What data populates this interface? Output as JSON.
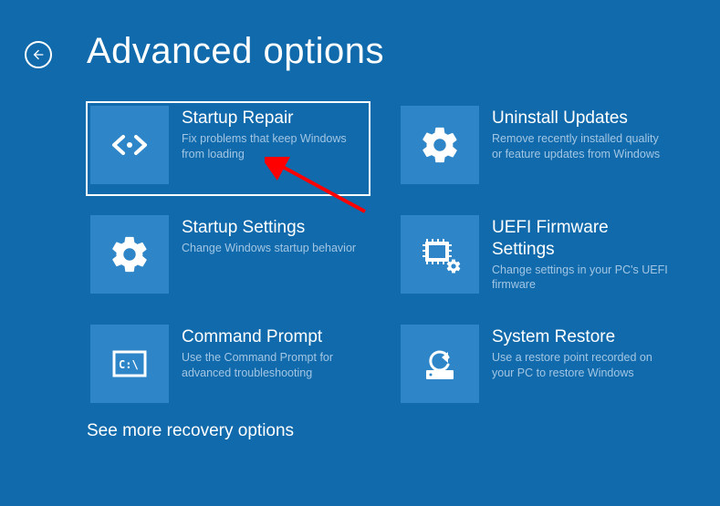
{
  "header": {
    "title": "Advanced options"
  },
  "tiles": {
    "startup_repair": {
      "title": "Startup Repair",
      "desc": "Fix problems that keep Windows from loading"
    },
    "uninstall_updates": {
      "title": "Uninstall Updates",
      "desc": "Remove recently installed quality or feature updates from Windows"
    },
    "startup_settings": {
      "title": "Startup Settings",
      "desc": "Change Windows startup behavior"
    },
    "uefi": {
      "title": "UEFI Firmware Settings",
      "desc": "Change settings in your PC's UEFI firmware"
    },
    "command_prompt": {
      "title": "Command Prompt",
      "desc": "Use the Command Prompt for advanced troubleshooting"
    },
    "system_restore": {
      "title": "System Restore",
      "desc": "Use a restore point recorded on your PC to restore Windows"
    }
  },
  "more_link": "See more recovery options",
  "colors": {
    "background": "#116aab",
    "tile_icon_bg": "#2e86c8",
    "desc_text": "#a2c6e4",
    "annotation_arrow": "#ff0000"
  }
}
